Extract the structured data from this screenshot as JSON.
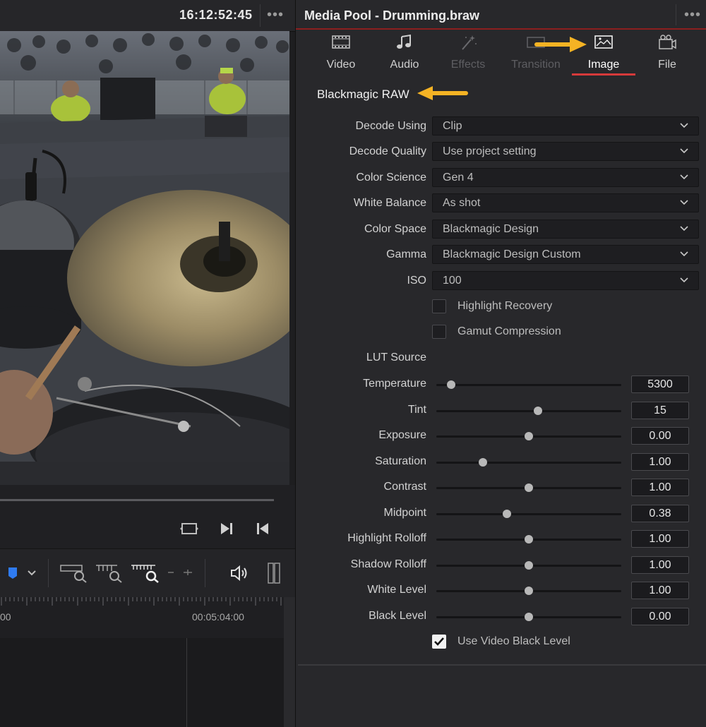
{
  "viewer": {
    "timecode": "16:12:52:45",
    "timeline_labels": [
      "00",
      "00:05:04:00"
    ]
  },
  "panel": {
    "title": "Media Pool - Drumming.braw",
    "tabs": [
      {
        "label": "Video",
        "icon": "film-icon",
        "state": "normal"
      },
      {
        "label": "Audio",
        "icon": "music-note-icon",
        "state": "normal"
      },
      {
        "label": "Effects",
        "icon": "magic-wand-icon",
        "state": "disabled"
      },
      {
        "label": "Transition",
        "icon": "transition-icon",
        "state": "disabled"
      },
      {
        "label": "Image",
        "icon": "image-icon",
        "state": "active"
      },
      {
        "label": "File",
        "icon": "file-icon",
        "state": "normal"
      }
    ],
    "section_title": "Blackmagic RAW",
    "dropdowns": [
      {
        "label": "Decode Using",
        "value": "Clip"
      },
      {
        "label": "Decode Quality",
        "value": "Use project setting"
      },
      {
        "label": "Color Science",
        "value": "Gen 4"
      },
      {
        "label": "White Balance",
        "value": "As shot"
      },
      {
        "label": "Color Space",
        "value": "Blackmagic Design"
      },
      {
        "label": "Gamma",
        "value": "Blackmagic Design Custom"
      },
      {
        "label": "ISO",
        "value": "100"
      }
    ],
    "checkboxes": [
      {
        "label": "Highlight Recovery",
        "checked": false
      },
      {
        "label": "Gamut Compression",
        "checked": false
      }
    ],
    "lut_source_label": "LUT Source",
    "sliders": [
      {
        "label": "Temperature",
        "value": "5300",
        "level": 0.08
      },
      {
        "label": "Tint",
        "value": "15",
        "level": 0.55
      },
      {
        "label": "Exposure",
        "value": "0.00",
        "level": 0.5
      },
      {
        "label": "Saturation",
        "value": "1.00",
        "level": 0.25
      },
      {
        "label": "Contrast",
        "value": "1.00",
        "level": 0.5
      },
      {
        "label": "Midpoint",
        "value": "0.38",
        "level": 0.38
      },
      {
        "label": "Highlight Rolloff",
        "value": "1.00",
        "level": 0.5
      },
      {
        "label": "Shadow Rolloff",
        "value": "1.00",
        "level": 0.5
      },
      {
        "label": "White Level",
        "value": "1.00",
        "level": 0.5
      },
      {
        "label": "Black Level",
        "value": "0.00",
        "level": 0.5
      }
    ],
    "video_black_level": {
      "label": "Use Video Black Level",
      "checked": true
    }
  },
  "colors": {
    "accent_red": "#d63a3a",
    "arrow_yellow": "#f5b324"
  }
}
